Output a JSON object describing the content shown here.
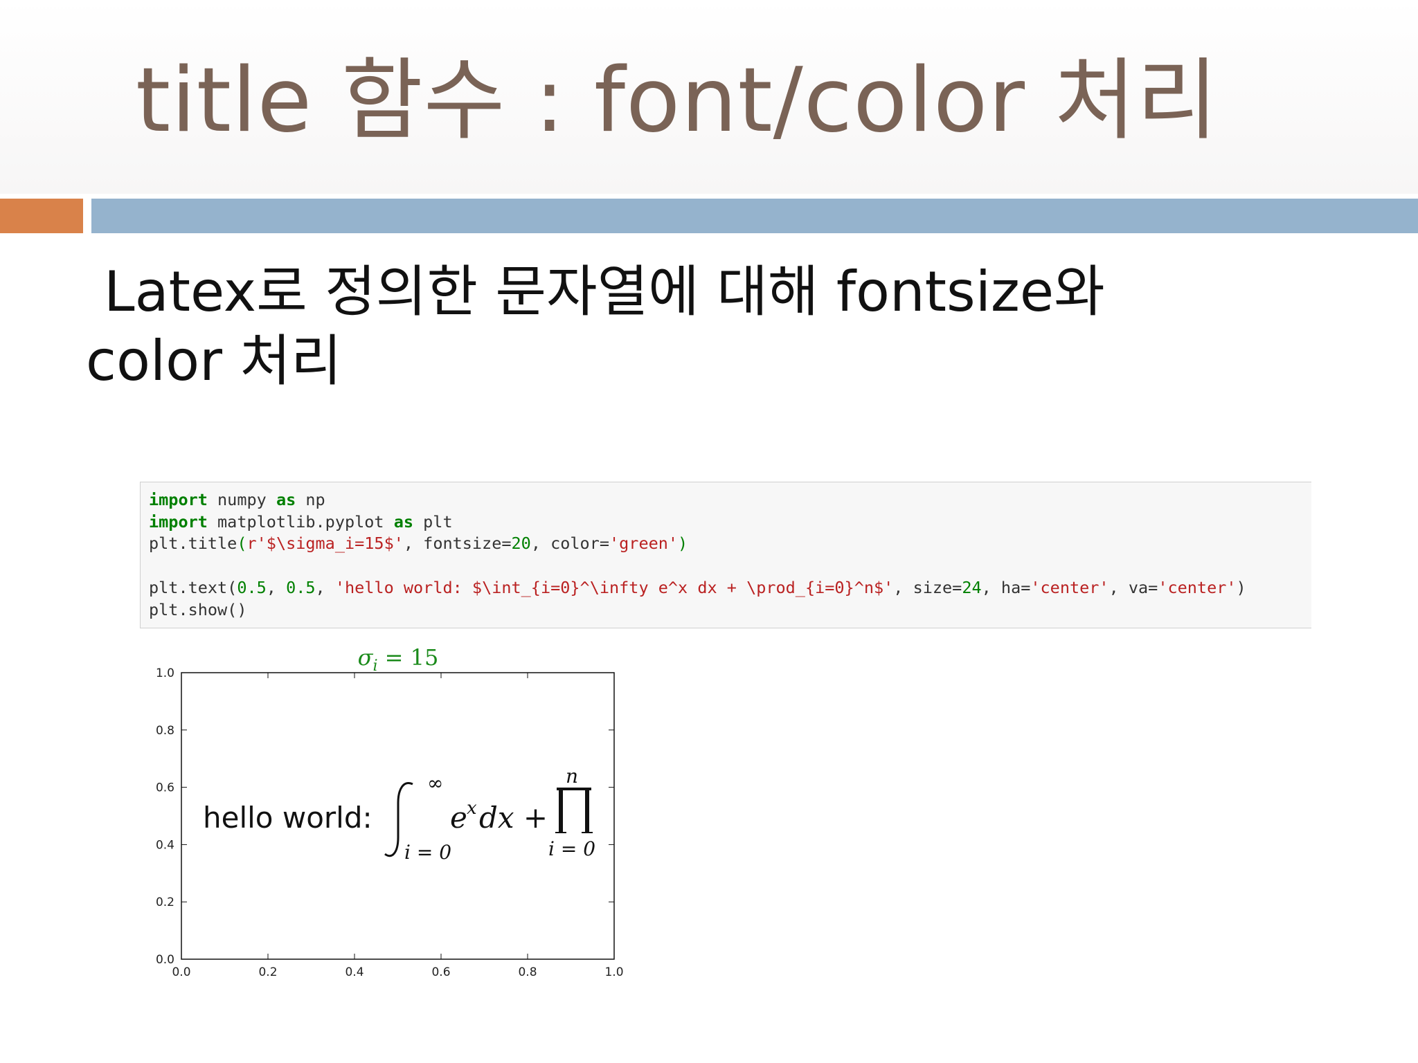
{
  "slide": {
    "title": "title 함수 :  font/color 처리",
    "subtitle_line1": "Latex로 정의한 문자열에 대해 fontsize와",
    "subtitle_line2": "color 처리"
  },
  "colors": {
    "title": "#7a6356",
    "accent_orange": "#d9824a",
    "accent_blue": "#95b3cd",
    "plot_title": "#1a8a1a"
  },
  "code": {
    "line1": {
      "kw1": "import",
      "mid": " numpy ",
      "kw2": "as",
      "end": " np"
    },
    "line2": {
      "kw1": "import",
      "mid": " matplotlib.pyplot ",
      "kw2": "as",
      "end": " plt"
    },
    "line3": {
      "a": "plt.title",
      "p1": "(",
      "b": "r'$\\sigma_i=15$'",
      "c": ", fontsize=",
      "d": "20",
      "e": ", color=",
      "f": "'green'",
      "p2": ")"
    },
    "line5": {
      "a": "plt.text(",
      "n1": "0.5",
      "s1": ", ",
      "n2": "0.5",
      "s2": ", ",
      "b": "'hello world: $\\int_{i=0}^\\infty e^x dx + \\prod_{i=0}^n$'",
      "c": ", size=",
      "n3": "24",
      "d": ", ha=",
      "e": "'center'",
      "f": ", va=",
      "g": "'center'",
      "h": ")"
    },
    "line6": "plt.show()"
  },
  "chart_data": {
    "type": "text",
    "title": "σi = 15",
    "xlim": [
      0.0,
      1.0
    ],
    "ylim": [
      0.0,
      1.0
    ],
    "x_ticks": [
      "0.0",
      "0.2",
      "0.4",
      "0.6",
      "0.8",
      "1.0"
    ],
    "y_ticks": [
      "0.0",
      "0.2",
      "0.4",
      "0.6",
      "0.8",
      "1.0"
    ],
    "annotation": {
      "x": 0.5,
      "y": 0.5,
      "text_prefix": "hello world:",
      "integral_lower": "i = 0",
      "integral_upper": "∞",
      "integrand_base": "e",
      "integrand_exp": "x",
      "differential": "dx +",
      "prod_lower": "i = 0",
      "prod_upper": "n"
    },
    "grid": false
  }
}
